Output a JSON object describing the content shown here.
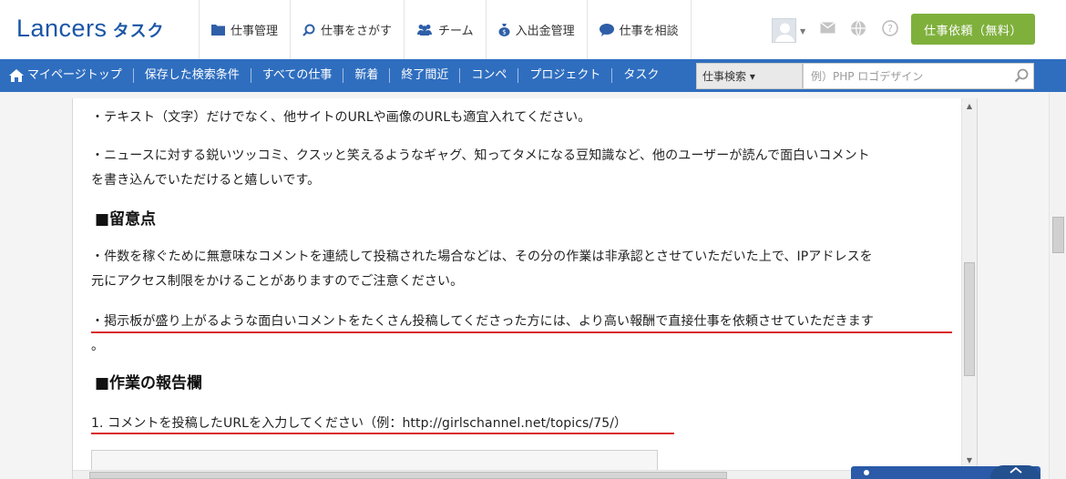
{
  "header": {
    "logo_text": "Lancers",
    "logo_sub": "タスク",
    "nav": [
      {
        "label": "仕事管理",
        "icon": "folder-icon"
      },
      {
        "label": "仕事をさがす",
        "icon": "search-icon"
      },
      {
        "label": "チーム",
        "icon": "team-icon"
      },
      {
        "label": "入出金管理",
        "icon": "money-bag-icon"
      },
      {
        "label": "仕事を相談",
        "icon": "chat-bubble-icon"
      }
    ],
    "cta_label": "仕事依頼（無料）",
    "colors": {
      "brand": "#1b56a6",
      "cta": "#7fb03c",
      "subnav": "#2f6ebf"
    }
  },
  "subnav": {
    "items": [
      "マイページトップ",
      "保存した検索条件",
      "すべての仕事",
      "新着",
      "終了間近",
      "コンペ",
      "プロジェクト",
      "タスク"
    ],
    "search_select": "仕事検索 ▾",
    "search_placeholder": "例）PHP ロゴデザイン"
  },
  "content": {
    "p1": "・テキスト（文字）だけでなく、他サイトのURLや画像のURLも適宜入れてください。",
    "p2a": "・ニュースに対する鋭いツッコミ、クスッと笑えるようなギャグ、知ってタメになる豆知識など、他のユーザーが読んで面白いコメント",
    "p2b": "を書き込んでいただけると嬉しいです。",
    "h1": "■留意点",
    "p3a": "・件数を稼ぐために無意味なコメントを連続して投稿された場合などは、その分の作業は非承認とさせていただいた上で、IPアドレスを",
    "p3b": "元にアクセス制限をかけることがありますのでご注意ください。",
    "p4a": "・掲示板が盛り上がるような面白いコメントをたくさん投稿してくださった方には、より高い報酬で直接仕事を依頼させていただきます",
    "p4b": "。",
    "h2": "■作業の報告欄",
    "p5": "1. コメントを投稿したURLを入力してください（例：http://girlschannel.net/topics/75/）"
  }
}
